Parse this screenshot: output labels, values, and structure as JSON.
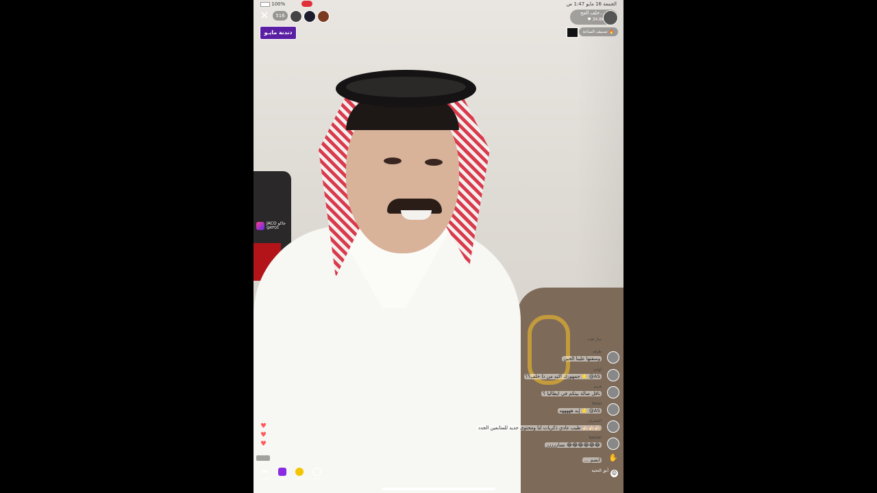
{
  "status_bar": {
    "time": "1:47 ص",
    "date": "الجمعة 16 مايو",
    "battery": "100%"
  },
  "top": {
    "viewer_count": "516",
    "host_name": "خلف الفح...",
    "host_likes": "34.8K",
    "ranking_label": "تصنيف الساعة",
    "badge_text": "دندنة مايـو"
  },
  "jaco": {
    "name": "JACO جاكو",
    "handle": "@KFQ1"
  },
  "comments": [
    {
      "user": "سار اهب",
      "text": ""
    },
    {
      "user": "ظرفه",
      "text": "وسقتها علينا الحين"
    },
    {
      "user": "لولبي",
      "text": "جمهورك اكيد من ذا خلف؟؟ 🌟 @AS"
    },
    {
      "user": "هـيـم",
      "text": "ناقل صالة بيتكم في ايطاليا ؟"
    },
    {
      "user": "Rafal",
      "text": "إيه هههههه 🌟 @AS"
    },
    {
      "user": "المشرف",
      "text": "طيب عادي ذكريات لنا ومحتوى جديد للمتابعين الجدد 👍🏻👍🏻👍🏻"
    },
    {
      "user": "RAHAF",
      "text": "نساززززز 😂😂😂😂😂😂"
    },
    {
      "user": "",
      "text": "... انضم"
    }
  ],
  "bottom": {
    "share": "المزيد",
    "gift": "هدية",
    "rewind": "إعادة ا...",
    "create": "وضع ته...",
    "comment_placeholder": "أبق التحية"
  }
}
